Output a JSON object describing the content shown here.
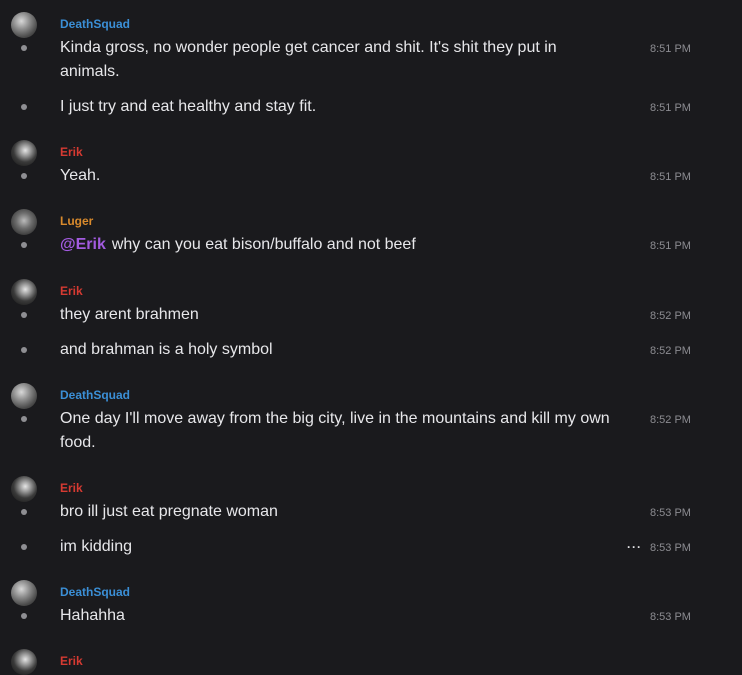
{
  "colors": {
    "background": "#1a1a1d",
    "deathsquad": "#3b8fd6",
    "erik": "#d63a32",
    "luger": "#d98a2c",
    "mention": "#a35be0"
  },
  "icons": {
    "avatar": "user-avatar",
    "more": "more-options-icon"
  },
  "messages": [
    {
      "user": "DeathSquad",
      "text": "Kinda gross, no wonder people get cancer and shit. It's shit they put in animals.",
      "time": "8:51 PM"
    },
    {
      "text": "I just try and eat healthy and stay fit.",
      "time": "8:51 PM"
    },
    {
      "user": "Erik",
      "text": "Yeah.",
      "time": "8:51 PM"
    },
    {
      "user": "Luger",
      "mention": "@Erik",
      "text": "why can you eat bison/buffalo and not beef",
      "time": "8:51 PM"
    },
    {
      "user": "Erik",
      "text": "they arent brahmen",
      "time": "8:52 PM"
    },
    {
      "text": "and brahman is a holy symbol",
      "time": "8:52 PM"
    },
    {
      "user": "DeathSquad",
      "text": "One day I'll move away from the big city, live in the mountains and kill my own food.",
      "time": "8:52 PM"
    },
    {
      "user": "Erik",
      "text": "bro ill just eat pregnate woman",
      "time": "8:53 PM"
    },
    {
      "text": "im kidding",
      "time": "8:53 PM",
      "more": "···"
    },
    {
      "user": "DeathSquad",
      "text": "Hahahha",
      "time": "8:53 PM"
    },
    {
      "user": "Erik"
    }
  ]
}
